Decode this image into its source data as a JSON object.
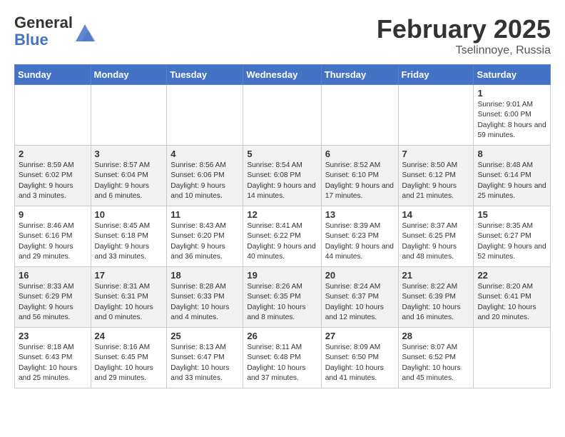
{
  "header": {
    "logo_general": "General",
    "logo_blue": "Blue",
    "month_title": "February 2025",
    "subtitle": "Tselinnoye, Russia"
  },
  "days_of_week": [
    "Sunday",
    "Monday",
    "Tuesday",
    "Wednesday",
    "Thursday",
    "Friday",
    "Saturday"
  ],
  "weeks": [
    [
      {
        "day": "",
        "info": ""
      },
      {
        "day": "",
        "info": ""
      },
      {
        "day": "",
        "info": ""
      },
      {
        "day": "",
        "info": ""
      },
      {
        "day": "",
        "info": ""
      },
      {
        "day": "",
        "info": ""
      },
      {
        "day": "1",
        "info": "Sunrise: 9:01 AM\nSunset: 6:00 PM\nDaylight: 8 hours and 59 minutes."
      }
    ],
    [
      {
        "day": "2",
        "info": "Sunrise: 8:59 AM\nSunset: 6:02 PM\nDaylight: 9 hours and 3 minutes."
      },
      {
        "day": "3",
        "info": "Sunrise: 8:57 AM\nSunset: 6:04 PM\nDaylight: 9 hours and 6 minutes."
      },
      {
        "day": "4",
        "info": "Sunrise: 8:56 AM\nSunset: 6:06 PM\nDaylight: 9 hours and 10 minutes."
      },
      {
        "day": "5",
        "info": "Sunrise: 8:54 AM\nSunset: 6:08 PM\nDaylight: 9 hours and 14 minutes."
      },
      {
        "day": "6",
        "info": "Sunrise: 8:52 AM\nSunset: 6:10 PM\nDaylight: 9 hours and 17 minutes."
      },
      {
        "day": "7",
        "info": "Sunrise: 8:50 AM\nSunset: 6:12 PM\nDaylight: 9 hours and 21 minutes."
      },
      {
        "day": "8",
        "info": "Sunrise: 8:48 AM\nSunset: 6:14 PM\nDaylight: 9 hours and 25 minutes."
      }
    ],
    [
      {
        "day": "9",
        "info": "Sunrise: 8:46 AM\nSunset: 6:16 PM\nDaylight: 9 hours and 29 minutes."
      },
      {
        "day": "10",
        "info": "Sunrise: 8:45 AM\nSunset: 6:18 PM\nDaylight: 9 hours and 33 minutes."
      },
      {
        "day": "11",
        "info": "Sunrise: 8:43 AM\nSunset: 6:20 PM\nDaylight: 9 hours and 36 minutes."
      },
      {
        "day": "12",
        "info": "Sunrise: 8:41 AM\nSunset: 6:22 PM\nDaylight: 9 hours and 40 minutes."
      },
      {
        "day": "13",
        "info": "Sunrise: 8:39 AM\nSunset: 6:23 PM\nDaylight: 9 hours and 44 minutes."
      },
      {
        "day": "14",
        "info": "Sunrise: 8:37 AM\nSunset: 6:25 PM\nDaylight: 9 hours and 48 minutes."
      },
      {
        "day": "15",
        "info": "Sunrise: 8:35 AM\nSunset: 6:27 PM\nDaylight: 9 hours and 52 minutes."
      }
    ],
    [
      {
        "day": "16",
        "info": "Sunrise: 8:33 AM\nSunset: 6:29 PM\nDaylight: 9 hours and 56 minutes."
      },
      {
        "day": "17",
        "info": "Sunrise: 8:31 AM\nSunset: 6:31 PM\nDaylight: 10 hours and 0 minutes."
      },
      {
        "day": "18",
        "info": "Sunrise: 8:28 AM\nSunset: 6:33 PM\nDaylight: 10 hours and 4 minutes."
      },
      {
        "day": "19",
        "info": "Sunrise: 8:26 AM\nSunset: 6:35 PM\nDaylight: 10 hours and 8 minutes."
      },
      {
        "day": "20",
        "info": "Sunrise: 8:24 AM\nSunset: 6:37 PM\nDaylight: 10 hours and 12 minutes."
      },
      {
        "day": "21",
        "info": "Sunrise: 8:22 AM\nSunset: 6:39 PM\nDaylight: 10 hours and 16 minutes."
      },
      {
        "day": "22",
        "info": "Sunrise: 8:20 AM\nSunset: 6:41 PM\nDaylight: 10 hours and 20 minutes."
      }
    ],
    [
      {
        "day": "23",
        "info": "Sunrise: 8:18 AM\nSunset: 6:43 PM\nDaylight: 10 hours and 25 minutes."
      },
      {
        "day": "24",
        "info": "Sunrise: 8:16 AM\nSunset: 6:45 PM\nDaylight: 10 hours and 29 minutes."
      },
      {
        "day": "25",
        "info": "Sunrise: 8:13 AM\nSunset: 6:47 PM\nDaylight: 10 hours and 33 minutes."
      },
      {
        "day": "26",
        "info": "Sunrise: 8:11 AM\nSunset: 6:48 PM\nDaylight: 10 hours and 37 minutes."
      },
      {
        "day": "27",
        "info": "Sunrise: 8:09 AM\nSunset: 6:50 PM\nDaylight: 10 hours and 41 minutes."
      },
      {
        "day": "28",
        "info": "Sunrise: 8:07 AM\nSunset: 6:52 PM\nDaylight: 10 hours and 45 minutes."
      },
      {
        "day": "",
        "info": ""
      }
    ]
  ]
}
